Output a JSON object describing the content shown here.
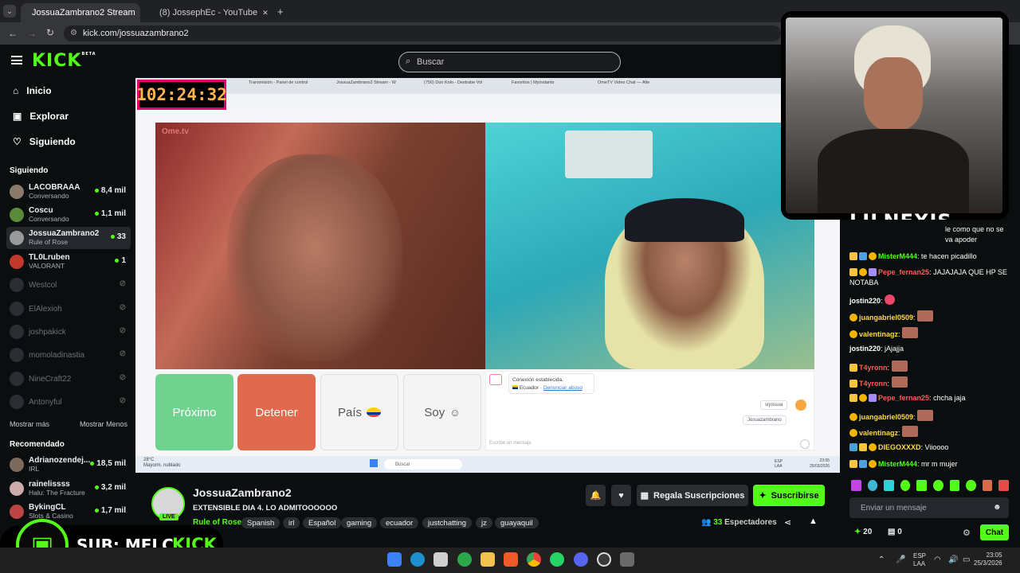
{
  "browser": {
    "tabs": [
      {
        "label": "JossuaZambrano2 Stream"
      },
      {
        "label": "(8) JossephEc - YouTube"
      }
    ],
    "url": "kick.com/jossuazambrano2"
  },
  "header": {
    "logo": "KICK",
    "logo_beta": "BETA",
    "search_placeholder": "Buscar"
  },
  "nav": {
    "items": [
      {
        "label": "Inicio"
      },
      {
        "label": "Explorar"
      },
      {
        "label": "Siguiendo"
      }
    ]
  },
  "following": {
    "title": "Siguiendo",
    "channels": [
      {
        "name": "LACOBRAAA",
        "sub": "Conversando",
        "viewers": "8,4 mil"
      },
      {
        "name": "Coscu",
        "sub": "Conversando",
        "viewers": "1,1 mil"
      },
      {
        "name": "JossuaZambrano2",
        "sub": "Rule of Rose",
        "viewers": "33"
      },
      {
        "name": "TL0Lruben",
        "sub": "VALORANT",
        "viewers": "1"
      },
      {
        "name": "Westcol"
      },
      {
        "name": "ElAlexioh"
      },
      {
        "name": "joshpakick"
      },
      {
        "name": "momoladinastia"
      },
      {
        "name": "NineCraft22"
      },
      {
        "name": "Antonyful"
      }
    ],
    "show_more": "Mostrar más",
    "show_less": "Mostrar Menos"
  },
  "recommended": {
    "title": "Recomendado",
    "channels": [
      {
        "name": "Adrianozendej...",
        "sub": "IRL",
        "viewers": "18,5 mil"
      },
      {
        "name": "rainelissss",
        "sub": "Halu: The Fracture",
        "viewers": "3,2 mil"
      },
      {
        "name": "BykingCL",
        "sub": "Slots & Casino",
        "viewers": "1,7 mil"
      }
    ]
  },
  "overlay": {
    "timer": "102:24:32",
    "sub_text": "SUB: MELC",
    "sub_logo": "KICK",
    "webcam_name": "LILNEXIS",
    "inner_tabs": [
      "Transmisión - Panel de control",
      "JossuaZambrano2 Stream - W",
      "(756) Don Kolo - Destrabe Vol",
      "Favoritos | Myinstants",
      "OmeTV Video Chat — Alte"
    ],
    "ometv_logo": "Ome.tv",
    "buttons": {
      "next": "Próximo",
      "stop": "Detener",
      "country": "País",
      "me": "Soy"
    },
    "conn_text": "Conexión establecida.",
    "conn_country": "Ecuador",
    "conn_report": "Denunciar abuso",
    "chat_bubbles": [
      "srjossua",
      "Josuazambrano"
    ],
    "chat_placeholder": "Escribe un mensaje",
    "inner_search": "Buscar",
    "weather": "28°C",
    "weather_sub": "Mayorm. nublado",
    "inner_lang": "ESP LAA",
    "inner_time": "23:05",
    "inner_date": "25/03/2026"
  },
  "stream": {
    "streamer": "JossuaZambrano2",
    "live_badge": "LIVE",
    "title": "EXTENSIBLE DIA 4. LO ADMITOOOOOO",
    "category": "Rule of Rose",
    "tags": [
      "Spanish",
      "irl",
      "Español",
      "gaming",
      "ecuador",
      "justchatting",
      "jz",
      "guayaquil"
    ],
    "gift_label": "Regala Suscripciones",
    "subscribe_label": "Suscribirse",
    "viewers_count": "33",
    "viewers_label": "Espectadores"
  },
  "chat": {
    "messages": [
      {
        "user": "",
        "text": "le como que no se va apoder"
      },
      {
        "user": "MisterM444",
        "color": "#53fc18",
        "text": "te hacen picadillo"
      },
      {
        "user": "Pepe_fernan25",
        "color": "#ff5a5a",
        "text": "JAJAJAJA QUE HP SE NOTABA"
      },
      {
        "user": "jostin220",
        "color": "#ffffff",
        "text": ""
      },
      {
        "user": "juangabriel0509",
        "color": "#ffd84d",
        "text": ""
      },
      {
        "user": "valentinagz",
        "color": "#ffd84d",
        "text": ""
      },
      {
        "user": "jostin220",
        "color": "#ffffff",
        "text": "jAjajja"
      },
      {
        "user": "T4yronn",
        "color": "#ff5a5a",
        "text": ""
      },
      {
        "user": "T4yronn",
        "color": "#ff5a5a",
        "text": ""
      },
      {
        "user": "Pepe_fernan25",
        "color": "#ff5a5a",
        "text": "chcha jaja"
      },
      {
        "user": "juangabriel0509",
        "color": "#ffd84d",
        "text": ""
      },
      {
        "user": "valentinagz",
        "color": "#ffd84d",
        "text": ""
      },
      {
        "user": "DIEGOXXXD",
        "color": "#ffd84d",
        "text": "Viioooo"
      },
      {
        "user": "MisterM444",
        "color": "#53fc18",
        "text": "mr m mujer"
      }
    ],
    "input_placeholder": "Enviar un mensaje",
    "points": "20",
    "gifts": "0",
    "chat_button": "Chat"
  },
  "taskbar": {
    "lang": "ESP",
    "lang2": "LAA",
    "time": "23:05",
    "date": "25/3/2026"
  },
  "colors": {
    "kick_green": "#53fc18",
    "bg": "#0b0e0f",
    "stop_red": "#e06a4e",
    "next_green": "#6fd28f"
  }
}
